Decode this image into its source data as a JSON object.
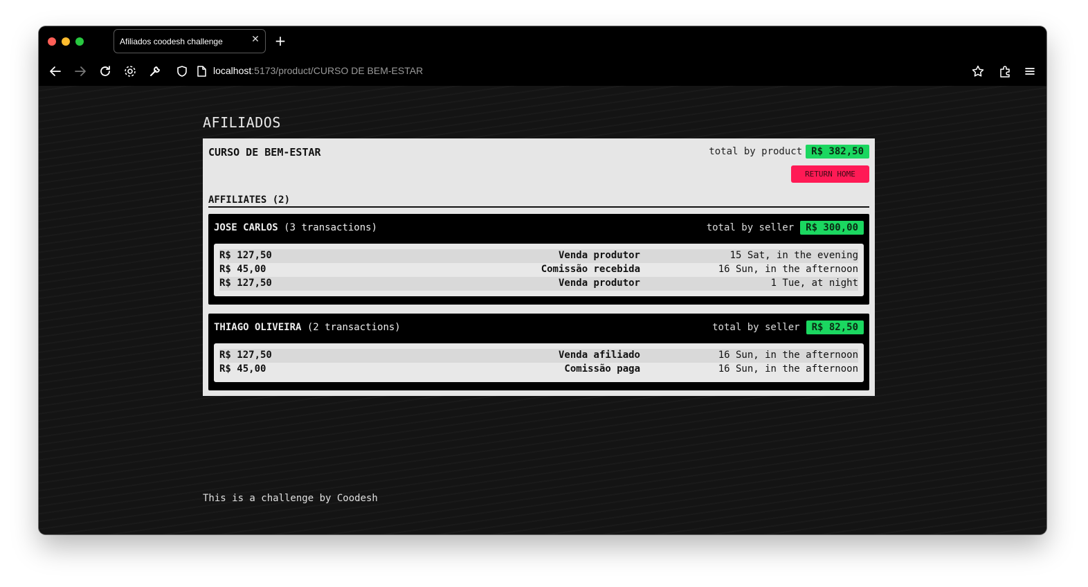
{
  "browser": {
    "tab_title": "Afiliados coodesh challenge",
    "tab_close_icon": "close-icon",
    "new_tab_icon": "plus-icon",
    "url_host": "localhost",
    "url_path": ":5173/product/CURSO DE BEM-ESTAR"
  },
  "page": {
    "heading": "AFILIADOS",
    "footer": "This is a challenge by Coodesh"
  },
  "product": {
    "name": "CURSO DE BEM-ESTAR",
    "total_label": "total by product",
    "total_value": "R$ 382,50",
    "return_label": "RETURN HOME",
    "affiliates_title": "AFFILIATES (2)"
  },
  "sellers": [
    {
      "name": "JOSE CARLOS",
      "count": "(3 transactions)",
      "total_label": "total by seller",
      "total_value": "R$ 300,00",
      "transactions": [
        {
          "value": "R$ 127,50",
          "type": "Venda produtor",
          "date": "15 Sat, in the evening"
        },
        {
          "value": "R$ 45,00",
          "type": "Comissão recebida",
          "date": "16 Sun, in the afternoon"
        },
        {
          "value": "R$ 127,50",
          "type": "Venda produtor",
          "date": "1 Tue, at night"
        }
      ]
    },
    {
      "name": "THIAGO OLIVEIRA",
      "count": "(2 transactions)",
      "total_label": "total by seller",
      "total_value": "R$ 82,50",
      "transactions": [
        {
          "value": "R$ 127,50",
          "type": "Venda afiliado",
          "date": "16 Sun, in the afternoon"
        },
        {
          "value": "R$ 45,00",
          "type": "Comissão paga",
          "date": "16 Sun, in the afternoon"
        }
      ]
    }
  ],
  "colors": {
    "money_badge": "#1bd760",
    "return_button": "#ff1a55",
    "page_background": "#141414"
  }
}
